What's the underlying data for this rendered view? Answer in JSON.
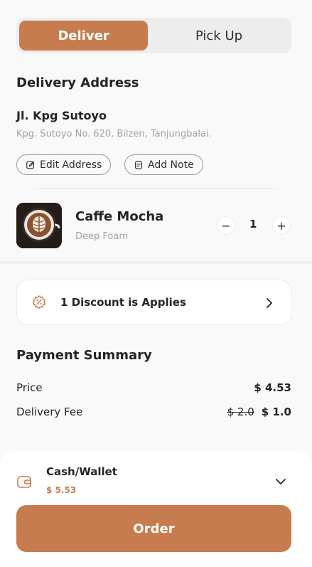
{
  "toggle": {
    "deliver": "Deliver",
    "pickup": "Pick Up"
  },
  "delivery": {
    "title": "Delivery Address",
    "name": "Jl. Kpg Sutoyo",
    "detail": "Kpg. Sutoyo No. 620, Bilzen, Tanjungbalai.",
    "edit_label": "Edit Address",
    "note_label": "Add Note"
  },
  "product": {
    "name": "Caffe Mocha",
    "subtitle": "Deep Foam",
    "quantity": "1",
    "minus": "−",
    "plus": "+"
  },
  "discount": {
    "label": "1 Discount is Applies"
  },
  "summary": {
    "title": "Payment Summary",
    "price_label": "Price",
    "price_value": "$ 4.53",
    "fee_label": "Delivery Fee",
    "fee_old": "$ 2.0",
    "fee_new": "$ 1.0"
  },
  "payment": {
    "method": "Cash/Wallet",
    "amount": "$ 5.53"
  },
  "order": {
    "label": "Order"
  },
  "colors": {
    "accent": "#c67c4e",
    "background": "#f9f9f9"
  }
}
